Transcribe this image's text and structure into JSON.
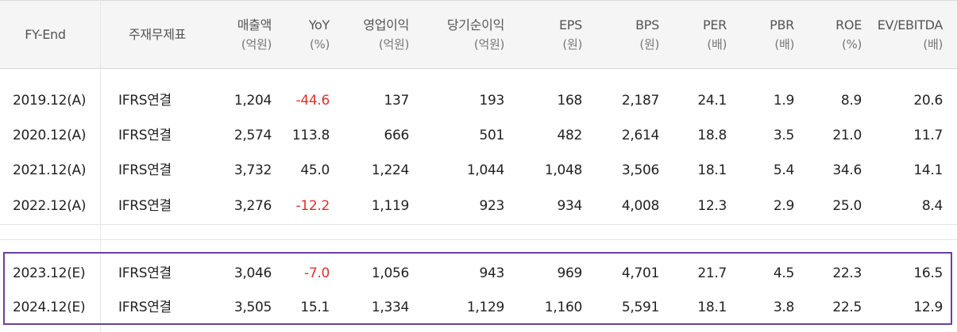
{
  "columns": [
    {
      "label": "FY-End",
      "unit": ""
    },
    {
      "label": "주재무제표",
      "unit": ""
    },
    {
      "label": "매출액",
      "unit": "(억원)"
    },
    {
      "label": "YoY",
      "unit": "(%)"
    },
    {
      "label": "영업이익",
      "unit": "(억원)"
    },
    {
      "label": "당기순이익",
      "unit": "(억원)"
    },
    {
      "label": "EPS",
      "unit": "(원)"
    },
    {
      "label": "BPS",
      "unit": "(원)"
    },
    {
      "label": "PER",
      "unit": "(배)"
    },
    {
      "label": "PBR",
      "unit": "(배)"
    },
    {
      "label": "ROE",
      "unit": "(%)"
    },
    {
      "label": "EV/EBITDA",
      "unit": "(배)"
    }
  ],
  "rows": [
    [
      "2019.12(A)",
      "IFRS연결",
      "1,204",
      "-44.6",
      "137",
      "193",
      "168",
      "2,187",
      "24.1",
      "1.9",
      "8.9",
      "20.6"
    ],
    [
      "2020.12(A)",
      "IFRS연결",
      "2,574",
      "113.8",
      "666",
      "501",
      "482",
      "2,614",
      "18.8",
      "3.5",
      "21.0",
      "11.7"
    ],
    [
      "2021.12(A)",
      "IFRS연결",
      "3,732",
      "45.0",
      "1,224",
      "1,044",
      "1,048",
      "3,506",
      "18.1",
      "5.4",
      "34.6",
      "14.1"
    ],
    [
      "2022.12(A)",
      "IFRS연결",
      "3,276",
      "-12.2",
      "1,119",
      "923",
      "934",
      "4,008",
      "12.3",
      "2.9",
      "25.0",
      "8.4"
    ],
    [
      "2023.12(E)",
      "IFRS연결",
      "3,046",
      "-7.0",
      "1,056",
      "943",
      "969",
      "4,701",
      "21.7",
      "4.5",
      "22.3",
      "16.5"
    ],
    [
      "2024.12(E)",
      "IFRS연결",
      "3,505",
      "15.1",
      "1,334",
      "1,129",
      "1,160",
      "5,591",
      "18.1",
      "3.8",
      "22.5",
      "12.9"
    ]
  ],
  "colors": {
    "negative": "#e0302c",
    "estimate_highlight": "#6a3fa0",
    "header_bg": "#f5f5f5"
  }
}
